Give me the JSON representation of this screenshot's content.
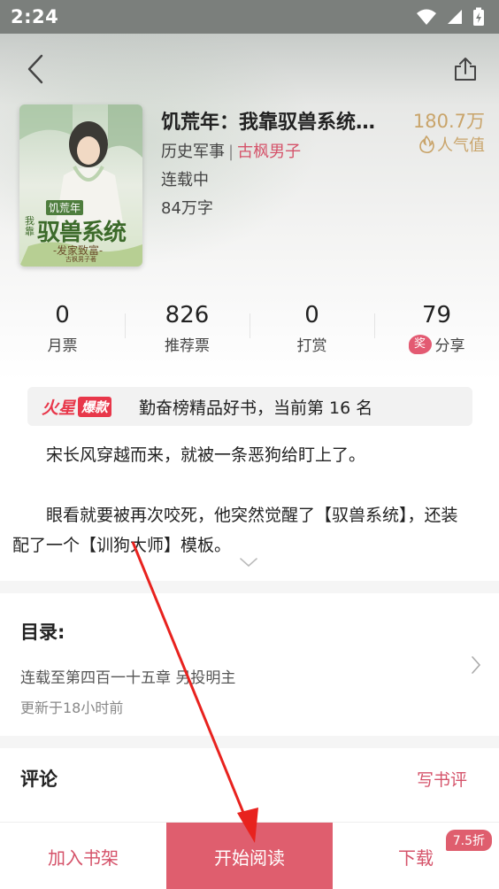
{
  "status_bar": {
    "time": "2:24"
  },
  "book": {
    "title": "饥荒年：我靠驭兽系统…",
    "category": "历史军事",
    "category_separator": "|",
    "tag": "古枫男子",
    "status": "连载中",
    "word_count": "84万字",
    "popularity_value": "180.7万",
    "popularity_label": "人气值",
    "cover": {
      "small_title": "饥荒年",
      "small_prefix": "我靠",
      "main_title": "驭兽系统",
      "subtitle": "-发家致富-",
      "author_line": "古枫男子著"
    }
  },
  "stats": [
    {
      "value": "0",
      "label": "月票"
    },
    {
      "value": "826",
      "label": "推荐票"
    },
    {
      "value": "0",
      "label": "打赏"
    },
    {
      "value": "79",
      "label": "分享",
      "badge": "奖"
    }
  ],
  "rank_banner": {
    "logo_a": "火星",
    "logo_b": "爆款",
    "text": "勤奋榜精品好书，当前第 16 名"
  },
  "synopsis": {
    "para1": "宋长风穿越而来，就被一条恶狗给盯上了。",
    "para2": "眼看就要被再次咬死，他突然觉醒了【驭兽系统】，还装配了一个【训狗大师】模板。"
  },
  "toc": {
    "title": "目录:",
    "latest": "连载至第四百一十五章 另投明主",
    "updated": "更新于18小时前"
  },
  "comments": {
    "title": "评论",
    "write_review": "写书评"
  },
  "bottom_bar": {
    "add_shelf": "加入书架",
    "start_read": "开始阅读",
    "download": "下载",
    "discount": "7.5折"
  },
  "colors": {
    "accent": "#df5e6e",
    "gold": "#c9a46a"
  }
}
